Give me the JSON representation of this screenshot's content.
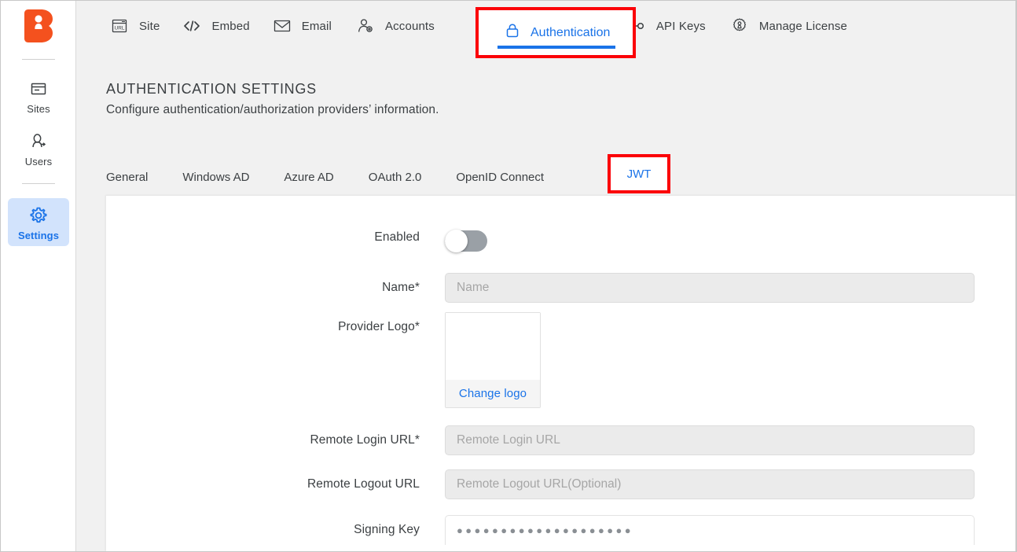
{
  "sidebar": {
    "logo_name": "brand-logo",
    "items": [
      {
        "label": "Sites",
        "icon": "sites-icon",
        "active": false
      },
      {
        "label": "Users",
        "icon": "users-icon",
        "active": false
      },
      {
        "label": "Settings",
        "icon": "gear-icon",
        "active": true
      }
    ]
  },
  "topnav": {
    "items": [
      {
        "label": "Site",
        "icon": "url-window-icon"
      },
      {
        "label": "Embed",
        "icon": "code-brackets-icon"
      },
      {
        "label": "Email",
        "icon": "envelope-icon"
      },
      {
        "label": "Accounts",
        "icon": "user-gear-icon"
      },
      {
        "label": "API Keys",
        "icon": "key-icon"
      },
      {
        "label": "Manage License",
        "icon": "license-gear-icon"
      }
    ],
    "active": {
      "label": "Authentication",
      "icon": "lock-icon"
    }
  },
  "header": {
    "title": "AUTHENTICATION SETTINGS",
    "subtitle": "Configure authentication/authorization providers’ information."
  },
  "subtabs": [
    {
      "label": "General",
      "active": false
    },
    {
      "label": "Windows AD",
      "active": false
    },
    {
      "label": "Azure AD",
      "active": false
    },
    {
      "label": "OAuth 2.0",
      "active": false
    },
    {
      "label": "OpenID Connect",
      "active": false
    },
    {
      "label": "JWT",
      "active": true
    }
  ],
  "form": {
    "enabled": {
      "label": "Enabled",
      "value": "off"
    },
    "name": {
      "label": "Name*",
      "value": "",
      "placeholder": "Name"
    },
    "provider_logo": {
      "label": "Provider Logo*",
      "change_link": "Change logo"
    },
    "remote_login_url": {
      "label": "Remote Login URL*",
      "value": "",
      "placeholder": "Remote Login URL"
    },
    "remote_logout_url": {
      "label": "Remote Logout URL",
      "value": "",
      "placeholder": "Remote Logout URL(Optional)"
    },
    "signing_key": {
      "label": "Signing Key",
      "masked_value": "●●●●●●●●●●●●●●●●●●●●"
    }
  },
  "colors": {
    "accent_blue": "#1a73e8",
    "brand_orange": "#f4511e",
    "annotation_red": "#fb0007",
    "page_bg": "#f1f1f1",
    "panel_bg": "#ffffff",
    "input_bg": "#ebebeb",
    "toggle_off": "#9aa0a6"
  }
}
